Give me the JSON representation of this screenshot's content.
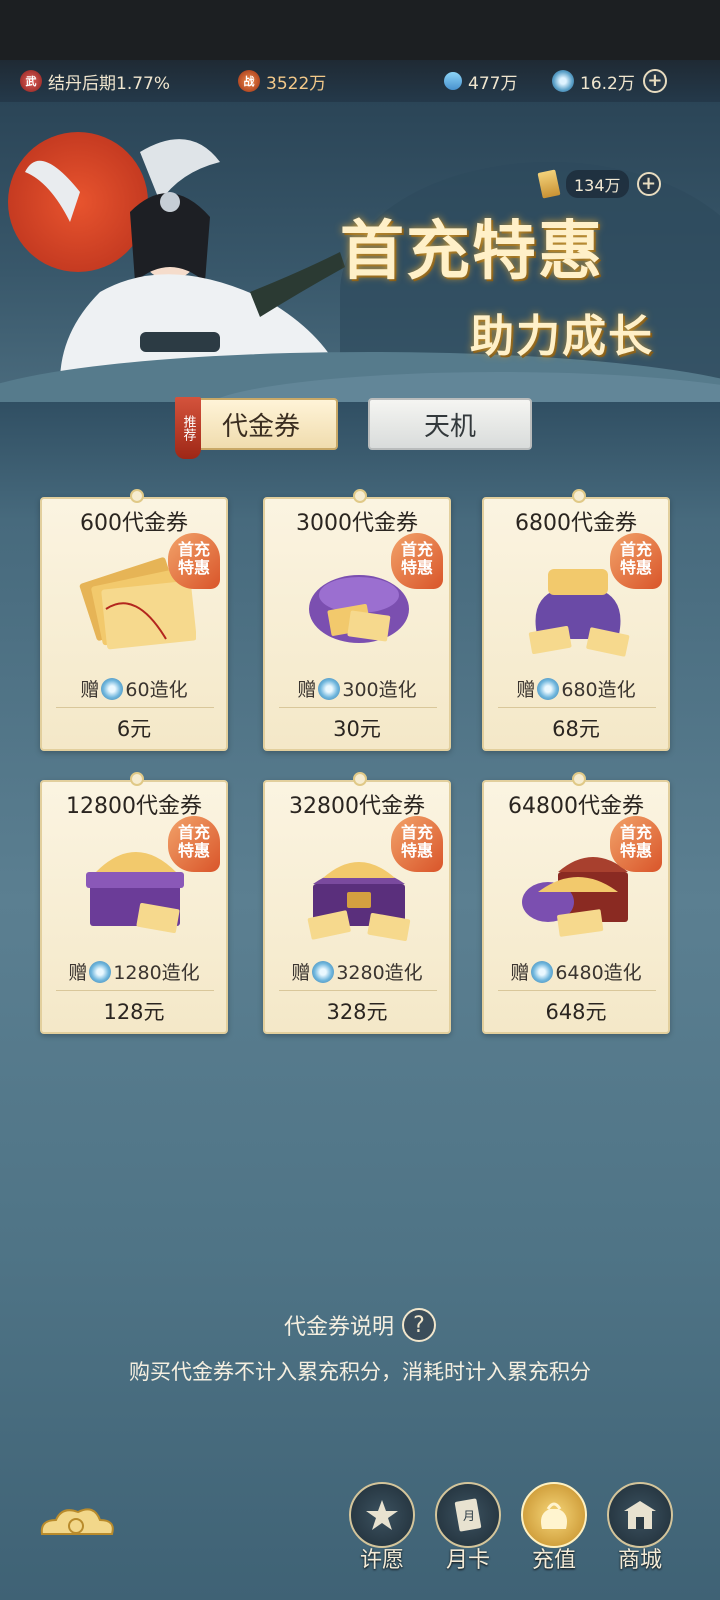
{
  "status_bar": {
    "realm_icon_char": "武",
    "realm_text": "结丹后期1.77%",
    "power_icon_char": "战",
    "power_value": "3522万",
    "crystal_value": "477万",
    "zaohua_value": "16.2万"
  },
  "banner": {
    "coupon_balance": "134万",
    "title_line1": "首充特惠",
    "title_line2": "助力成长"
  },
  "tabs": {
    "recommend_tag": "推荐",
    "active": "代金券",
    "inactive": "天机"
  },
  "cards": [
    {
      "name": "600代金券",
      "badge_l1": "首充",
      "badge_l2": "特惠",
      "gift_prefix": "赠",
      "gift_amount": "60造化",
      "price": "6元"
    },
    {
      "name": "3000代金券",
      "badge_l1": "首充",
      "badge_l2": "特惠",
      "gift_prefix": "赠",
      "gift_amount": "300造化",
      "price": "30元"
    },
    {
      "name": "6800代金券",
      "badge_l1": "首充",
      "badge_l2": "特惠",
      "gift_prefix": "赠",
      "gift_amount": "680造化",
      "price": "68元"
    },
    {
      "name": "12800代金券",
      "badge_l1": "首充",
      "badge_l2": "特惠",
      "gift_prefix": "赠",
      "gift_amount": "1280造化",
      "price": "128元"
    },
    {
      "name": "32800代金券",
      "badge_l1": "首充",
      "badge_l2": "特惠",
      "gift_prefix": "赠",
      "gift_amount": "3280造化",
      "price": "328元"
    },
    {
      "name": "64800代金券",
      "badge_l1": "首充",
      "badge_l2": "特惠",
      "gift_prefix": "赠",
      "gift_amount": "6480造化",
      "price": "648元"
    }
  ],
  "explain": {
    "title": "代金券说明",
    "help_glyph": "?",
    "description": "购买代金券不计入累充积分，消耗时计入累充积分"
  },
  "bottom_nav": [
    {
      "label": "许愿",
      "icon": "wish-icon"
    },
    {
      "label": "月卡",
      "icon": "month-card-icon"
    },
    {
      "label": "充值",
      "icon": "recharge-icon",
      "active": true
    },
    {
      "label": "商城",
      "icon": "shop-icon"
    }
  ],
  "colors": {
    "accent_gold": "#f0dcae",
    "badge_orange": "#d9552a",
    "card_bg": "#fbf4e1",
    "bg_teal": "#5b7f91"
  }
}
